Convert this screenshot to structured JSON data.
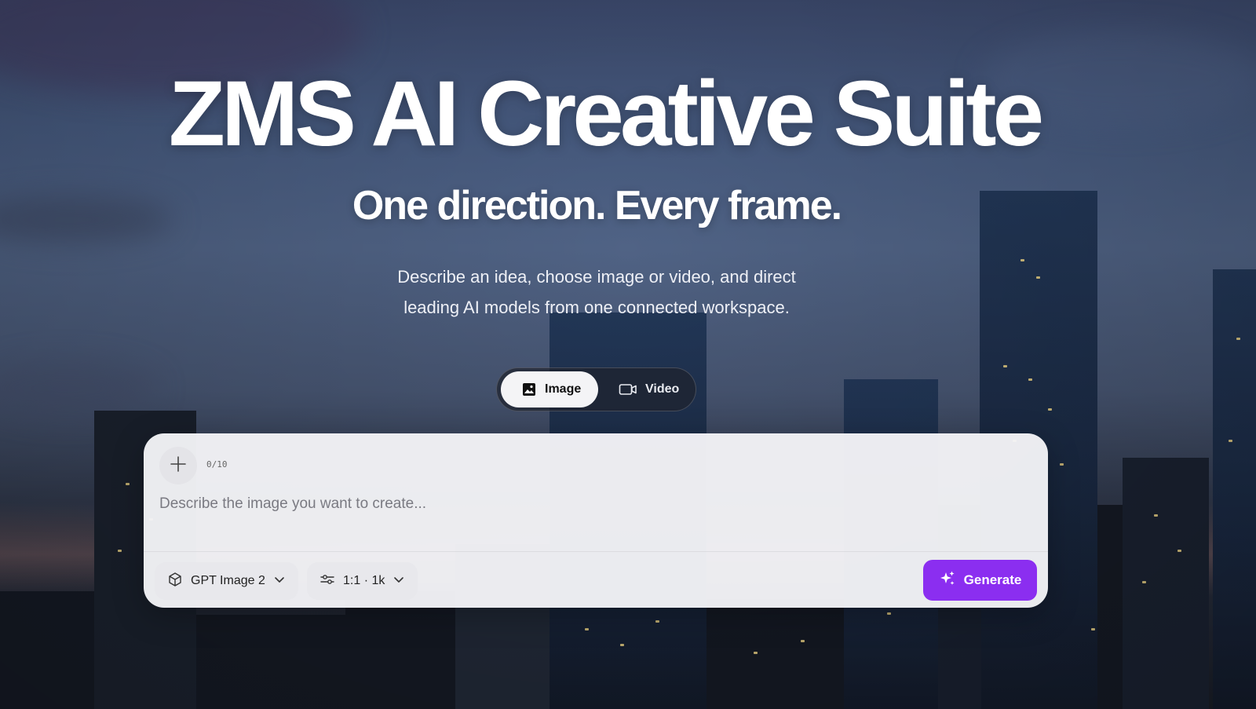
{
  "hero": {
    "title": "ZMS AI Creative Suite",
    "subtitle": "One direction. Every frame.",
    "description_line1": "Describe an idea, choose image or video, and direct",
    "description_line2": "leading AI models from one connected workspace."
  },
  "mode_switch": {
    "tabs": [
      {
        "label": "Image",
        "icon": "image-icon",
        "active": true
      },
      {
        "label": "Video",
        "icon": "video-camera-icon",
        "active": false
      }
    ]
  },
  "composer": {
    "attachment_count": "0/10",
    "prompt_placeholder": "Describe the image you want to create...",
    "prompt_value": "",
    "model_label": "GPT Image 2",
    "settings_label": "1:1 · 1k",
    "generate_label": "Generate"
  },
  "colors": {
    "accent": "#8b2ef0",
    "composer_bg": "#f4f4f7"
  }
}
